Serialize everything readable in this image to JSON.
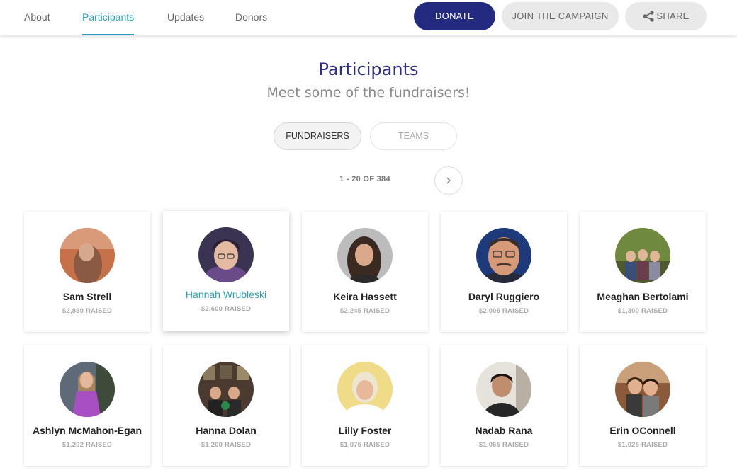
{
  "nav": {
    "tabs": [
      {
        "label": "About"
      },
      {
        "label": "Participants"
      },
      {
        "label": "Updates"
      },
      {
        "label": "Donors"
      }
    ],
    "donate_label": "DONATE",
    "join_label": "JOIN THE CAMPAIGN",
    "share_label": "SHARE",
    "donate_color": "#232a7f",
    "active_color": "#2aa1b6"
  },
  "header": {
    "title": "Participants",
    "subtitle": "Meet some of the fundraisers!"
  },
  "toggle": {
    "fundraisers_label": "FUNDRAISERS",
    "teams_label": "TEAMS"
  },
  "pager": {
    "text": "1 - 20 OF 384",
    "next_icon": "chevron-right-icon"
  },
  "participants": [
    {
      "name": "Sam Strell",
      "raised": "$2,850 RAISED"
    },
    {
      "name": "Hannah Wrubleski",
      "raised": "$2,600 RAISED"
    },
    {
      "name": "Keira Hassett",
      "raised": "$2,245 RAISED"
    },
    {
      "name": "Daryl Ruggiero",
      "raised": "$2,005 RAISED"
    },
    {
      "name": "Meaghan Bertolami",
      "raised": "$1,300 RAISED"
    },
    {
      "name": "Ashlyn McMahon-Egan",
      "raised": "$1,202 RAISED"
    },
    {
      "name": "Hanna Dolan",
      "raised": "$1,200 RAISED"
    },
    {
      "name": "Lilly Foster",
      "raised": "$1,075 RAISED"
    },
    {
      "name": "Nadab Rana",
      "raised": "$1,065 RAISED"
    },
    {
      "name": "Erin OConnell",
      "raised": "$1,025 RAISED"
    }
  ]
}
